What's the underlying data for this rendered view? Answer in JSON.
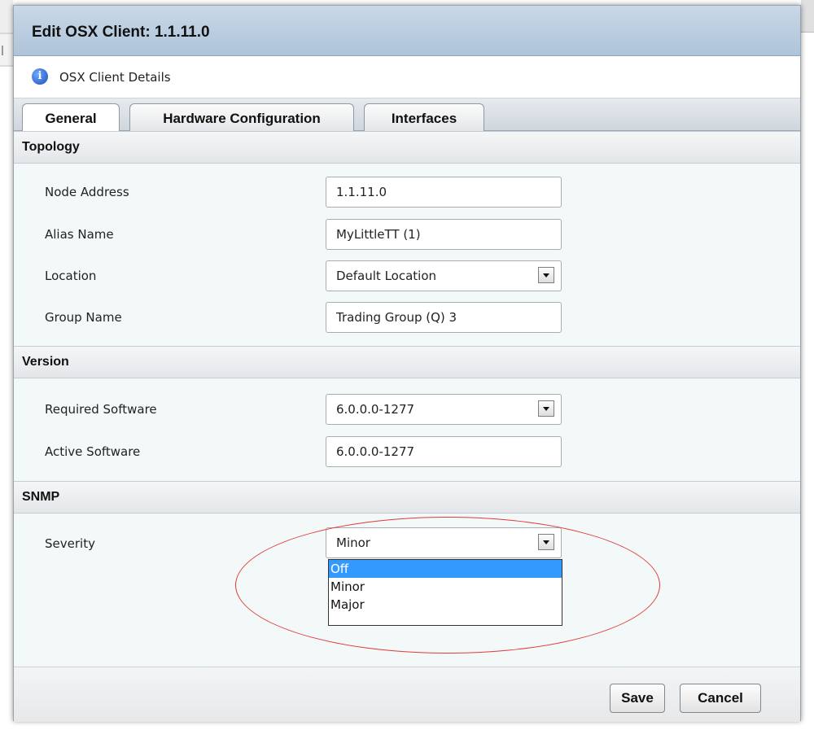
{
  "dialog": {
    "title": "Edit OSX Client: 1.1.11.0",
    "details_label": "OSX Client Details"
  },
  "tabs": [
    {
      "label": "General"
    },
    {
      "label": "Hardware Configuration"
    },
    {
      "label": "Interfaces"
    }
  ],
  "topology": {
    "header": "Topology",
    "node_address_label": "Node Address",
    "node_address_value": "1.1.11.0",
    "alias_name_label": "Alias Name",
    "alias_name_value": "MyLittleTT (1)",
    "location_label": "Location",
    "location_value": "Default Location",
    "group_name_label": "Group Name",
    "group_name_value": "Trading Group (Q) 3"
  },
  "version": {
    "header": "Version",
    "required_software_label": "Required Software",
    "required_software_value": "6.0.0.0-1277",
    "active_software_label": "Active Software",
    "active_software_value": "6.0.0.0-1277"
  },
  "snmp": {
    "header": "SNMP",
    "severity_label": "Severity",
    "severity_value": "Minor",
    "severity_options": [
      "Off",
      "Minor",
      "Major"
    ],
    "highlighted_option": "Off"
  },
  "footer": {
    "save_label": "Save",
    "cancel_label": "Cancel"
  },
  "colors": {
    "title_bar": "#aec4d9",
    "dropdown_highlight": "#3399ff",
    "annotation_ellipse": "#e23a3a"
  },
  "icons": {
    "info": "info-icon",
    "dropdown_arrow": "chevron-down-icon"
  }
}
